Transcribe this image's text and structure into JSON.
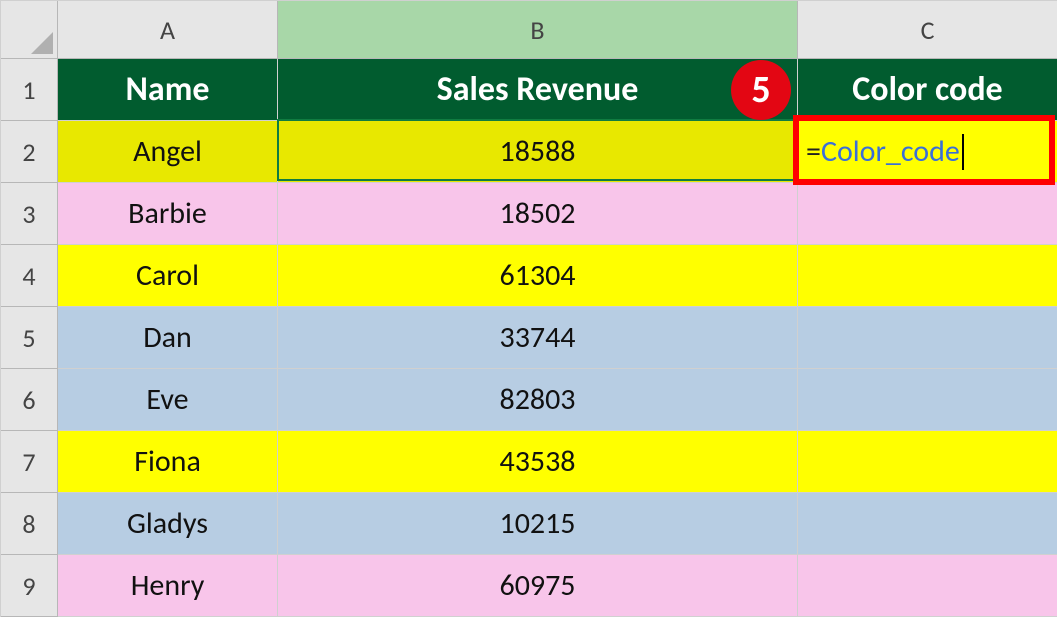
{
  "columns": [
    "A",
    "B",
    "C"
  ],
  "row_headers": [
    "1",
    "2",
    "3",
    "4",
    "5",
    "6",
    "7",
    "8",
    "9"
  ],
  "selected_column": "B",
  "headers": {
    "a": "Name",
    "b": "Sales Revenue",
    "c": "Color code"
  },
  "rows": [
    {
      "name": "Angel",
      "revenue": "18588",
      "fill": "editing"
    },
    {
      "name": "Barbie",
      "revenue": "18502",
      "fill": "pink"
    },
    {
      "name": "Carol",
      "revenue": "61304",
      "fill": "yellow"
    },
    {
      "name": "Dan",
      "revenue": "33744",
      "fill": "blue"
    },
    {
      "name": "Eve",
      "revenue": "82803",
      "fill": "blue"
    },
    {
      "name": "Fiona",
      "revenue": "43538",
      "fill": "yellow"
    },
    {
      "name": "Gladys",
      "revenue": "10215",
      "fill": "blue"
    },
    {
      "name": "Henry",
      "revenue": "60975",
      "fill": "pink"
    }
  ],
  "formula": {
    "prefix": "=",
    "body": "Color_code"
  },
  "callout": {
    "number": "5"
  }
}
